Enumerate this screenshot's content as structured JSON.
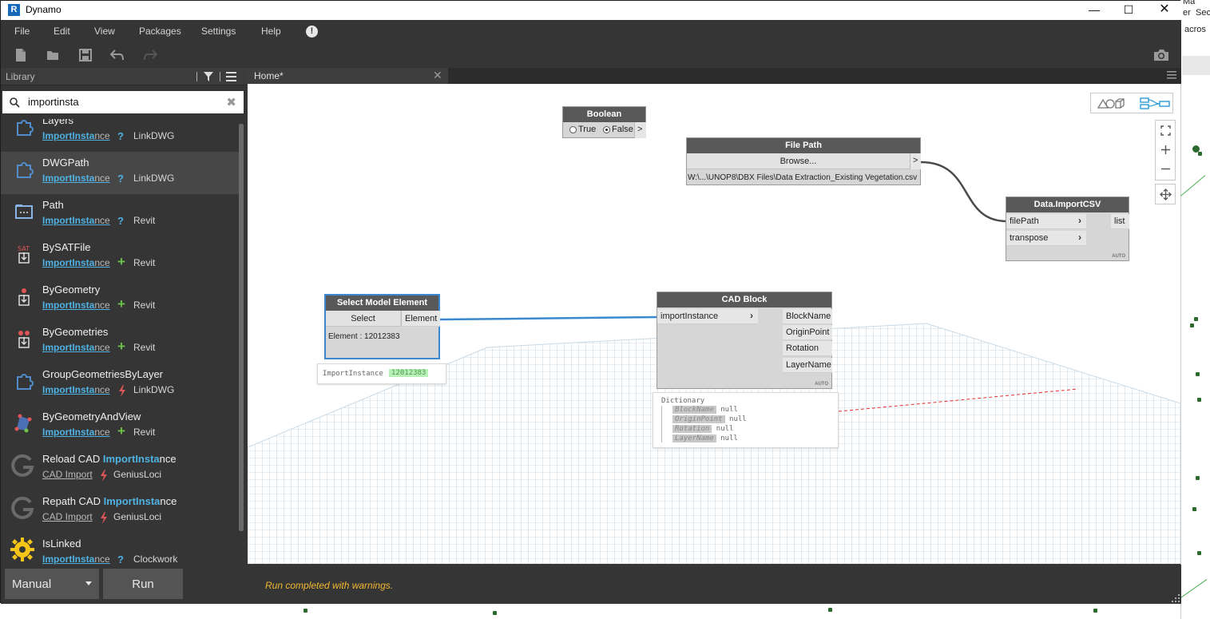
{
  "window": {
    "title": "Dynamo",
    "app_icon": "R"
  },
  "background_app": {
    "texts": [
      "Ma",
      "er",
      "Sec",
      "acros"
    ]
  },
  "menu": [
    "File",
    "Edit",
    "View",
    "Packages",
    "Settings",
    "Help"
  ],
  "library": {
    "title": "Library",
    "search_value": "importinsta",
    "items": [
      {
        "name": "Layers",
        "cat_hl": "ImportInsta",
        "cat_rest": "nce",
        "type": "?",
        "pkg": "LinkDWG",
        "icon": "puzzle-icon"
      },
      {
        "name": "DWGPath",
        "cat_hl": "ImportInsta",
        "cat_rest": "nce",
        "type": "?",
        "pkg": "LinkDWG",
        "icon": "puzzle-icon"
      },
      {
        "name": "Path",
        "cat_hl": "ImportInsta",
        "cat_rest": "nce",
        "type": "?",
        "pkg": "Revit",
        "icon": "path-icon"
      },
      {
        "name": "BySATFile",
        "cat_hl": "ImportInsta",
        "cat_rest": "nce",
        "type": "+",
        "pkg": "Revit",
        "icon": "sat-icon",
        "icon_text": "SAT"
      },
      {
        "name": "ByGeometry",
        "cat_hl": "ImportInsta",
        "cat_rest": "nce",
        "type": "+",
        "pkg": "Revit",
        "icon": "geometry-icon"
      },
      {
        "name": "ByGeometries",
        "cat_hl": "ImportInsta",
        "cat_rest": "nce",
        "type": "+",
        "pkg": "Revit",
        "icon": "geometries-icon"
      },
      {
        "name": "GroupGeometriesByLayer",
        "cat_hl": "ImportInsta",
        "cat_rest": "nce",
        "type": "bolt",
        "pkg": "LinkDWG",
        "icon": "puzzle-icon"
      },
      {
        "name": "ByGeometryAndView",
        "cat_hl": "ImportInsta",
        "cat_rest": "nce",
        "type": "+",
        "pkg": "Revit",
        "icon": "geometry-view-icon"
      },
      {
        "name_pre": "Reload CAD ",
        "name_hl": "ImportInsta",
        "name_post": "nce",
        "cat": "CAD Import",
        "type": "bolt",
        "pkg": "GeniusLoci",
        "icon": "genius-loci-icon"
      },
      {
        "name_pre": "Repath CAD ",
        "name_hl": "ImportInsta",
        "name_post": "nce",
        "cat": "CAD Import",
        "type": "bolt",
        "pkg": "GeniusLoci",
        "icon": "genius-loci-icon"
      },
      {
        "name": "IsLinked",
        "cat_hl": "ImportInsta",
        "cat_rest": "nce",
        "type": "?",
        "pkg": "Clockwork",
        "icon": "clockwork-icon"
      }
    ]
  },
  "tabs": [
    {
      "label": "Home*"
    }
  ],
  "nodes": {
    "boolean": {
      "title": "Boolean",
      "opt_true": "True",
      "opt_false": "False",
      "selected": "False",
      "out": ">"
    },
    "file_path": {
      "title": "File Path",
      "browse": "Browse...",
      "out": ">",
      "value": "W:\\...\\UNOP8\\DBX Files\\Data Extraction_Existing Vegetation.csv"
    },
    "import_csv": {
      "title": "Data.ImportCSV",
      "in1": "filePath",
      "in2": "transpose",
      "out": "list",
      "lacing": "AUTO"
    },
    "select_model": {
      "title": "Select Model Element",
      "button": "Select",
      "out": "Element",
      "info": "Element : 12012383",
      "preview_type": "ImportInstance",
      "preview_value": "12012383"
    },
    "cad_block": {
      "title": "CAD Block",
      "in1": "importInstance",
      "outs": [
        "BlockName",
        "OriginPoint",
        "Rotation",
        "LayerName"
      ],
      "lacing": "AUTO",
      "preview_title": "Dictionary",
      "preview_rows": [
        {
          "key": "BlockName",
          "val": "null"
        },
        {
          "key": "OriginPoint",
          "val": "null"
        },
        {
          "key": "Rotation",
          "val": "null"
        },
        {
          "key": "LayerName",
          "val": "null"
        }
      ]
    }
  },
  "status": {
    "run_mode": "Manual",
    "run_button": "Run",
    "message": "Run completed with warnings."
  },
  "colors": {
    "accent": "#4fb2e3",
    "warning": "#f2b830",
    "wire_selected": "#3a88d0"
  }
}
